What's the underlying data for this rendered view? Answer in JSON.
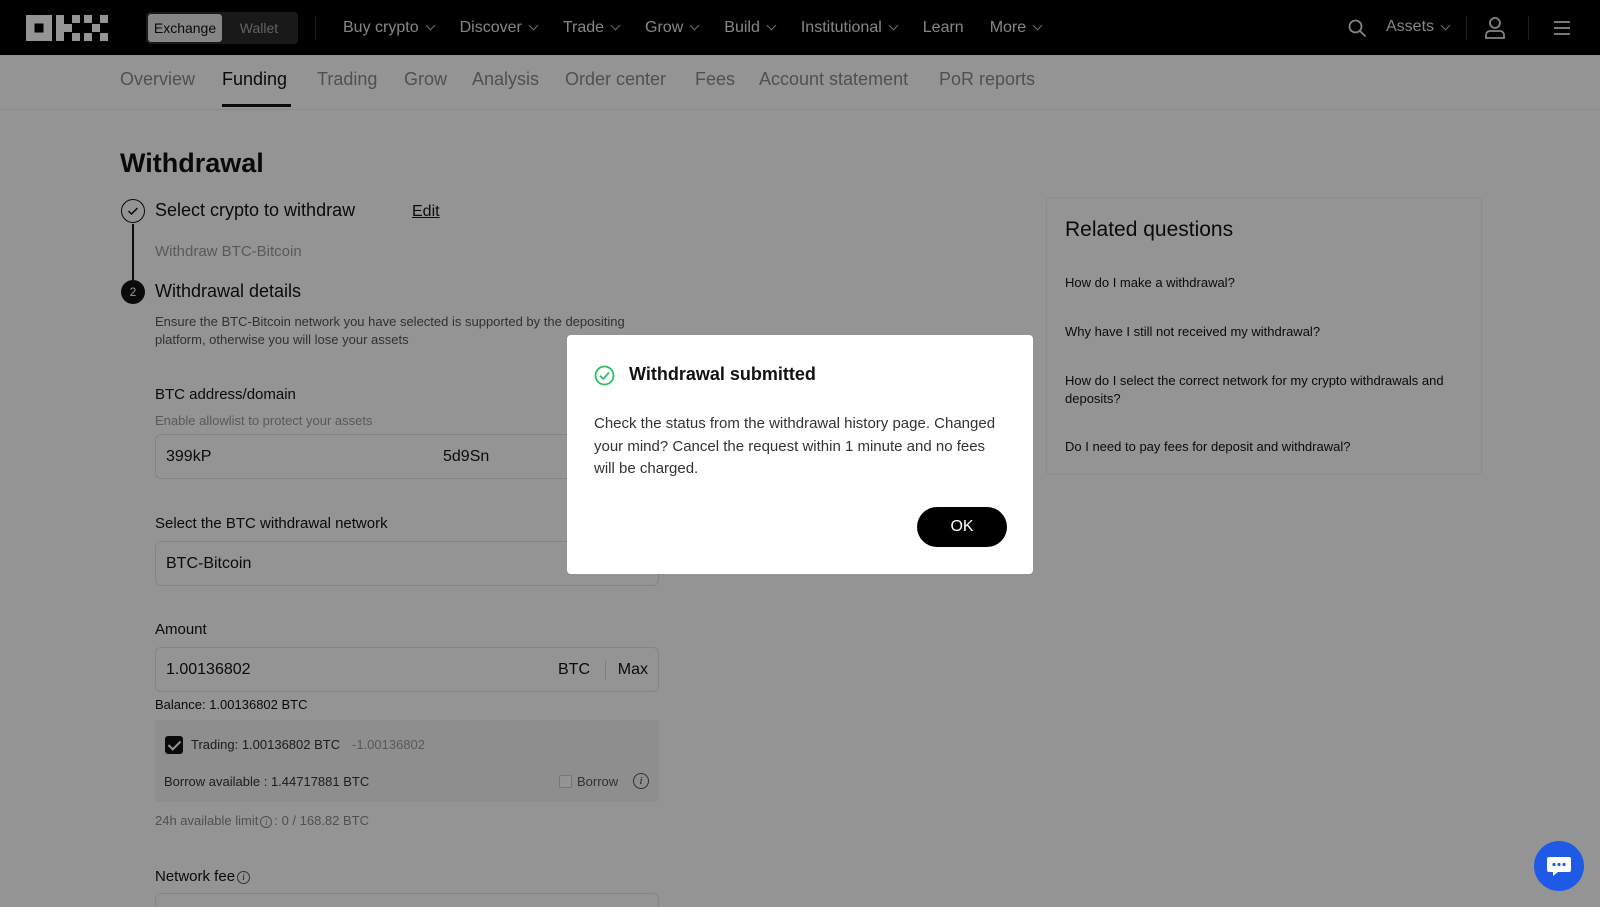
{
  "nav": {
    "segment": [
      "Exchange",
      "Wallet"
    ],
    "items": [
      "Buy crypto",
      "Discover",
      "Trade",
      "Grow",
      "Build",
      "Institutional",
      "Learn",
      "More"
    ],
    "assets": "Assets"
  },
  "tabs": [
    "Overview",
    "Funding",
    "Trading",
    "Grow",
    "Analysis",
    "Order center",
    "Fees",
    "Account statement",
    "PoR reports"
  ],
  "page": {
    "title": "Withdrawal",
    "step1_title": "Select crypto to withdraw",
    "step1_edit": "Edit",
    "step1_value": "Withdraw BTC-Bitcoin",
    "step2_number": "2",
    "step2_title": "Withdrawal details",
    "warning": "Ensure the BTC-Bitcoin network you have selected is supported by the depositing platform, otherwise you will lose your assets",
    "address_label": "BTC address/domain",
    "address_hint": "Enable allowlist to protect your assets",
    "address_part1": "399kP",
    "address_part2": "5d9Sn",
    "network_label": "Select the BTC withdrawal network",
    "network_value": "BTC-Bitcoin",
    "amount_label": "Amount",
    "amount_value": "1.00136802",
    "amount_unit": "BTC",
    "amount_max": "Max",
    "balance": "Balance: 1.00136802 BTC",
    "trading": "Trading: 1.00136802 BTC",
    "trading_delta": "-1.00136802",
    "borrow_available": "Borrow available : 1.44717881 BTC",
    "borrow": "Borrow",
    "limit_prefix": "24h available limit",
    "limit_value": ": 0 / 168.82 BTC",
    "network_fee": "Network fee"
  },
  "related": {
    "title": "Related questions",
    "questions": [
      "How do I make a withdrawal?",
      "Why have I still not received my withdrawal?",
      "How do I select the correct network for my crypto withdrawals and deposits?",
      "Do I need to pay fees for deposit and withdrawal?"
    ]
  },
  "modal": {
    "title": "Withdrawal submitted",
    "body": "Check the status from the withdrawal history page. Changed your mind? Cancel the request within 1 minute and no fees will be charged.",
    "ok": "OK"
  },
  "colors": {
    "success": "#2bbf6a",
    "chat": "#1f5ae6"
  }
}
